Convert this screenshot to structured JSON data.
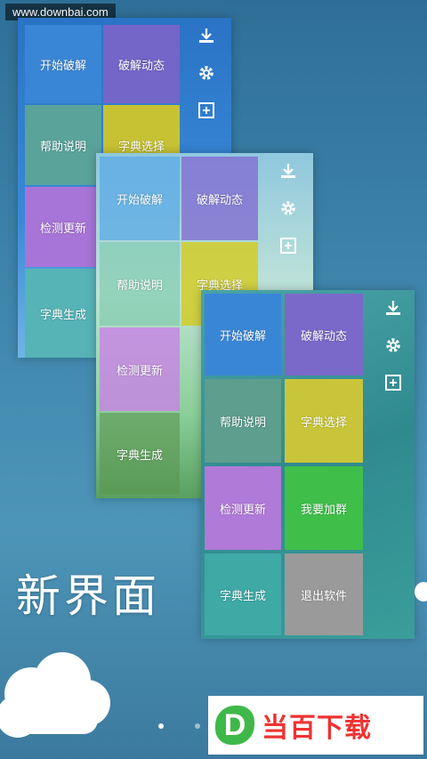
{
  "watermark": "www.downbai.com",
  "tagline": "新界面",
  "logo": {
    "mark": "D",
    "text": "当百下载"
  },
  "cards": [
    {
      "tiles": [
        "开始破解",
        "破解动态",
        "帮助说明",
        "字典选择",
        "检测更新",
        "字典生成"
      ],
      "icons": [
        "download-icon",
        "gear-icon",
        "plus-box-icon"
      ]
    },
    {
      "tiles": [
        "开始破解",
        "破解动态",
        "帮助说明",
        "字典选择",
        "检测更新",
        "字典生成"
      ],
      "icons": [
        "download-icon",
        "gear-icon",
        "plus-box-icon"
      ]
    },
    {
      "tiles": [
        "开始破解",
        "破解动态",
        "帮助说明",
        "字典选择",
        "检测更新",
        "我要加群",
        "字典生成",
        "退出软件"
      ],
      "icons": [
        "download-icon",
        "gear-icon",
        "plus-box-icon"
      ]
    }
  ],
  "colors": {
    "blue": "#3a86d6",
    "purple": "#7b69c9",
    "green": "#5aa89a",
    "yellow": "#c9c53a",
    "lavender": "#b07ad8",
    "bright_green": "#3fbf4a",
    "gray": "#9a9a9a",
    "teal": "#3fa9a6",
    "logo_green": "#3fb84a",
    "logo_red": "#e33333"
  }
}
